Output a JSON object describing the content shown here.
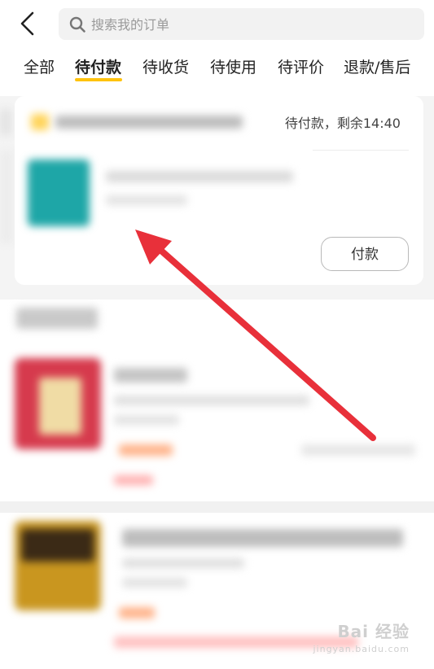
{
  "search": {
    "placeholder": "搜索我的订单",
    "icon": "search-icon"
  },
  "nav": {
    "back_icon": "chevron-left-icon"
  },
  "tabs": [
    {
      "label": "全部",
      "active": false
    },
    {
      "label": "待付款",
      "active": true
    },
    {
      "label": "待收货",
      "active": false
    },
    {
      "label": "待使用",
      "active": false
    },
    {
      "label": "待评价",
      "active": false
    },
    {
      "label": "退款/售后",
      "active": false
    }
  ],
  "order": {
    "status": "待付款，剩余14:40",
    "pay_button_label": "付款"
  },
  "watermark": {
    "main": "Bai 经验",
    "sub": "jingyan.baidu.com"
  },
  "colors": {
    "tab_underline": "#ffc30e",
    "annotation_arrow": "#e8303a",
    "page_background": "#f4f4f4"
  }
}
